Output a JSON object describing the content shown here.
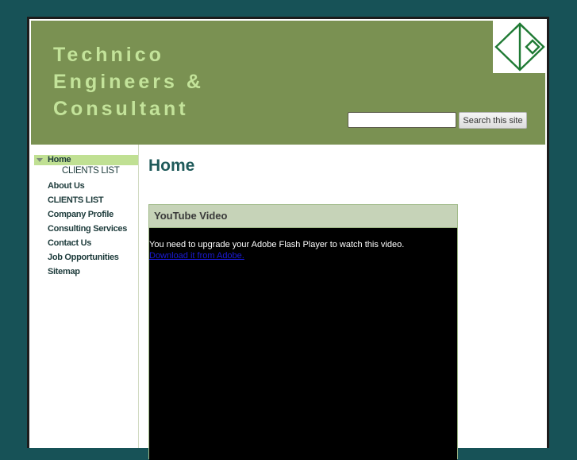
{
  "header": {
    "title_lines": [
      "Technico",
      "Engineers &",
      "Consultant"
    ],
    "logo_icon": "diamond-arrow-logo-icon",
    "search": {
      "input_value": "",
      "input_placeholder": "",
      "button_label": "Search this site"
    }
  },
  "sidebar": {
    "items": [
      {
        "label": "Home",
        "active": true,
        "expanded": true,
        "icon": "triangle-down-icon"
      },
      {
        "label": "CLIENTS LIST",
        "sub": true
      },
      {
        "label": "About Us"
      },
      {
        "label": "CLIENTS LIST"
      },
      {
        "label": "Company Profile"
      },
      {
        "label": "Consulting Services"
      },
      {
        "label": "Contact Us"
      },
      {
        "label": "Job Opportunities"
      },
      {
        "label": "Sitemap"
      }
    ]
  },
  "main": {
    "page_title": "Home",
    "video_widget": {
      "title": "YouTube Video",
      "message": "You need to upgrade your Adobe Flash Player to watch this video.",
      "link_text": "Download it from Adobe."
    }
  },
  "colors": {
    "background": "#175257",
    "header": "#7a9152",
    "title_text": "#c3e39a",
    "nav_active": "#c0e093",
    "heading": "#1f5a5a",
    "video_header": "#c6d3b8"
  }
}
